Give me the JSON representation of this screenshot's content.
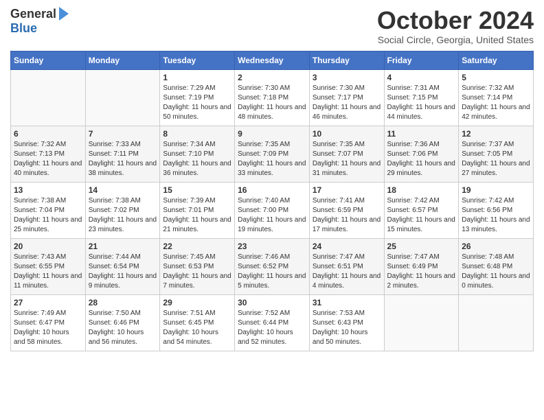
{
  "header": {
    "logo_general": "General",
    "logo_blue": "Blue",
    "month_title": "October 2024",
    "location": "Social Circle, Georgia, United States"
  },
  "weekdays": [
    "Sunday",
    "Monday",
    "Tuesday",
    "Wednesday",
    "Thursday",
    "Friday",
    "Saturday"
  ],
  "weeks": [
    [
      {
        "day": "",
        "sunrise": "",
        "sunset": "",
        "daylight": ""
      },
      {
        "day": "",
        "sunrise": "",
        "sunset": "",
        "daylight": ""
      },
      {
        "day": "1",
        "sunrise": "Sunrise: 7:29 AM",
        "sunset": "Sunset: 7:19 PM",
        "daylight": "Daylight: 11 hours and 50 minutes."
      },
      {
        "day": "2",
        "sunrise": "Sunrise: 7:30 AM",
        "sunset": "Sunset: 7:18 PM",
        "daylight": "Daylight: 11 hours and 48 minutes."
      },
      {
        "day": "3",
        "sunrise": "Sunrise: 7:30 AM",
        "sunset": "Sunset: 7:17 PM",
        "daylight": "Daylight: 11 hours and 46 minutes."
      },
      {
        "day": "4",
        "sunrise": "Sunrise: 7:31 AM",
        "sunset": "Sunset: 7:15 PM",
        "daylight": "Daylight: 11 hours and 44 minutes."
      },
      {
        "day": "5",
        "sunrise": "Sunrise: 7:32 AM",
        "sunset": "Sunset: 7:14 PM",
        "daylight": "Daylight: 11 hours and 42 minutes."
      }
    ],
    [
      {
        "day": "6",
        "sunrise": "Sunrise: 7:32 AM",
        "sunset": "Sunset: 7:13 PM",
        "daylight": "Daylight: 11 hours and 40 minutes."
      },
      {
        "day": "7",
        "sunrise": "Sunrise: 7:33 AM",
        "sunset": "Sunset: 7:11 PM",
        "daylight": "Daylight: 11 hours and 38 minutes."
      },
      {
        "day": "8",
        "sunrise": "Sunrise: 7:34 AM",
        "sunset": "Sunset: 7:10 PM",
        "daylight": "Daylight: 11 hours and 36 minutes."
      },
      {
        "day": "9",
        "sunrise": "Sunrise: 7:35 AM",
        "sunset": "Sunset: 7:09 PM",
        "daylight": "Daylight: 11 hours and 33 minutes."
      },
      {
        "day": "10",
        "sunrise": "Sunrise: 7:35 AM",
        "sunset": "Sunset: 7:07 PM",
        "daylight": "Daylight: 11 hours and 31 minutes."
      },
      {
        "day": "11",
        "sunrise": "Sunrise: 7:36 AM",
        "sunset": "Sunset: 7:06 PM",
        "daylight": "Daylight: 11 hours and 29 minutes."
      },
      {
        "day": "12",
        "sunrise": "Sunrise: 7:37 AM",
        "sunset": "Sunset: 7:05 PM",
        "daylight": "Daylight: 11 hours and 27 minutes."
      }
    ],
    [
      {
        "day": "13",
        "sunrise": "Sunrise: 7:38 AM",
        "sunset": "Sunset: 7:04 PM",
        "daylight": "Daylight: 11 hours and 25 minutes."
      },
      {
        "day": "14",
        "sunrise": "Sunrise: 7:38 AM",
        "sunset": "Sunset: 7:02 PM",
        "daylight": "Daylight: 11 hours and 23 minutes."
      },
      {
        "day": "15",
        "sunrise": "Sunrise: 7:39 AM",
        "sunset": "Sunset: 7:01 PM",
        "daylight": "Daylight: 11 hours and 21 minutes."
      },
      {
        "day": "16",
        "sunrise": "Sunrise: 7:40 AM",
        "sunset": "Sunset: 7:00 PM",
        "daylight": "Daylight: 11 hours and 19 minutes."
      },
      {
        "day": "17",
        "sunrise": "Sunrise: 7:41 AM",
        "sunset": "Sunset: 6:59 PM",
        "daylight": "Daylight: 11 hours and 17 minutes."
      },
      {
        "day": "18",
        "sunrise": "Sunrise: 7:42 AM",
        "sunset": "Sunset: 6:57 PM",
        "daylight": "Daylight: 11 hours and 15 minutes."
      },
      {
        "day": "19",
        "sunrise": "Sunrise: 7:42 AM",
        "sunset": "Sunset: 6:56 PM",
        "daylight": "Daylight: 11 hours and 13 minutes."
      }
    ],
    [
      {
        "day": "20",
        "sunrise": "Sunrise: 7:43 AM",
        "sunset": "Sunset: 6:55 PM",
        "daylight": "Daylight: 11 hours and 11 minutes."
      },
      {
        "day": "21",
        "sunrise": "Sunrise: 7:44 AM",
        "sunset": "Sunset: 6:54 PM",
        "daylight": "Daylight: 11 hours and 9 minutes."
      },
      {
        "day": "22",
        "sunrise": "Sunrise: 7:45 AM",
        "sunset": "Sunset: 6:53 PM",
        "daylight": "Daylight: 11 hours and 7 minutes."
      },
      {
        "day": "23",
        "sunrise": "Sunrise: 7:46 AM",
        "sunset": "Sunset: 6:52 PM",
        "daylight": "Daylight: 11 hours and 5 minutes."
      },
      {
        "day": "24",
        "sunrise": "Sunrise: 7:47 AM",
        "sunset": "Sunset: 6:51 PM",
        "daylight": "Daylight: 11 hours and 4 minutes."
      },
      {
        "day": "25",
        "sunrise": "Sunrise: 7:47 AM",
        "sunset": "Sunset: 6:49 PM",
        "daylight": "Daylight: 11 hours and 2 minutes."
      },
      {
        "day": "26",
        "sunrise": "Sunrise: 7:48 AM",
        "sunset": "Sunset: 6:48 PM",
        "daylight": "Daylight: 11 hours and 0 minutes."
      }
    ],
    [
      {
        "day": "27",
        "sunrise": "Sunrise: 7:49 AM",
        "sunset": "Sunset: 6:47 PM",
        "daylight": "Daylight: 10 hours and 58 minutes."
      },
      {
        "day": "28",
        "sunrise": "Sunrise: 7:50 AM",
        "sunset": "Sunset: 6:46 PM",
        "daylight": "Daylight: 10 hours and 56 minutes."
      },
      {
        "day": "29",
        "sunrise": "Sunrise: 7:51 AM",
        "sunset": "Sunset: 6:45 PM",
        "daylight": "Daylight: 10 hours and 54 minutes."
      },
      {
        "day": "30",
        "sunrise": "Sunrise: 7:52 AM",
        "sunset": "Sunset: 6:44 PM",
        "daylight": "Daylight: 10 hours and 52 minutes."
      },
      {
        "day": "31",
        "sunrise": "Sunrise: 7:53 AM",
        "sunset": "Sunset: 6:43 PM",
        "daylight": "Daylight: 10 hours and 50 minutes."
      },
      {
        "day": "",
        "sunrise": "",
        "sunset": "",
        "daylight": ""
      },
      {
        "day": "",
        "sunrise": "",
        "sunset": "",
        "daylight": ""
      }
    ]
  ]
}
